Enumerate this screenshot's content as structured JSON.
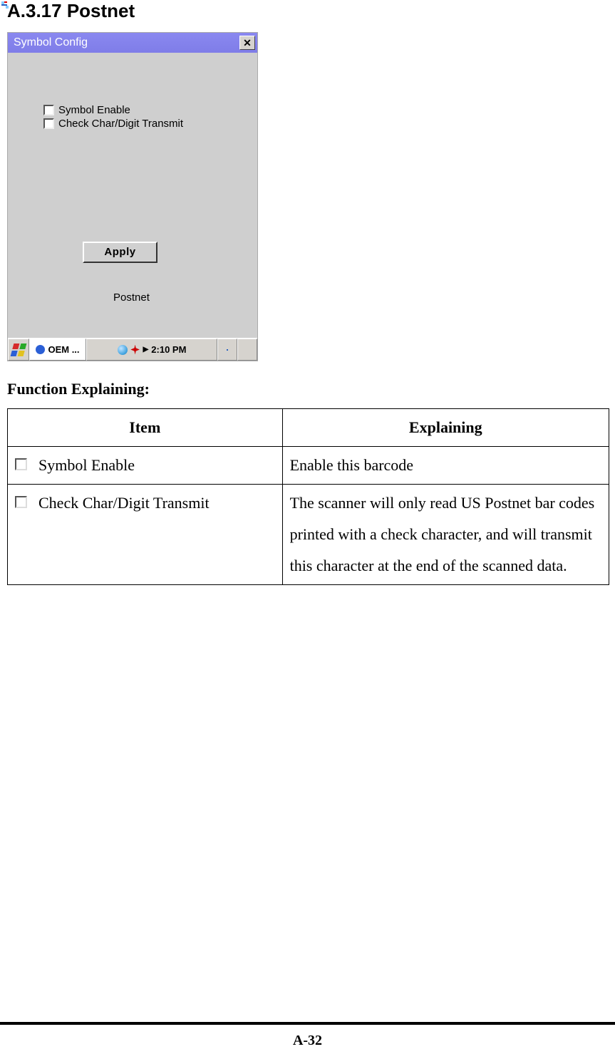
{
  "heading": "A.3.17 Postnet",
  "dialog": {
    "title": "Symbol Config",
    "checkbox1_label": "Symbol Enable",
    "checkbox2_label": "Check Char/Digit Transmit",
    "apply_label": "Apply",
    "sublabel": "Postnet"
  },
  "taskbar": {
    "app_label": "OEM ...",
    "clock": "2:10 PM"
  },
  "function_heading": "Function Explaining:",
  "table": {
    "header_item": "Item",
    "header_explaining": "Explaining",
    "rows": [
      {
        "item": "Symbol Enable",
        "explaining": "Enable this barcode"
      },
      {
        "item": "Check Char/Digit Transmit",
        "explaining": "The scanner will only read US Postnet bar codes printed with a check character, and will transmit this character at the end of the scanned data."
      }
    ]
  },
  "page_number": "A-32"
}
